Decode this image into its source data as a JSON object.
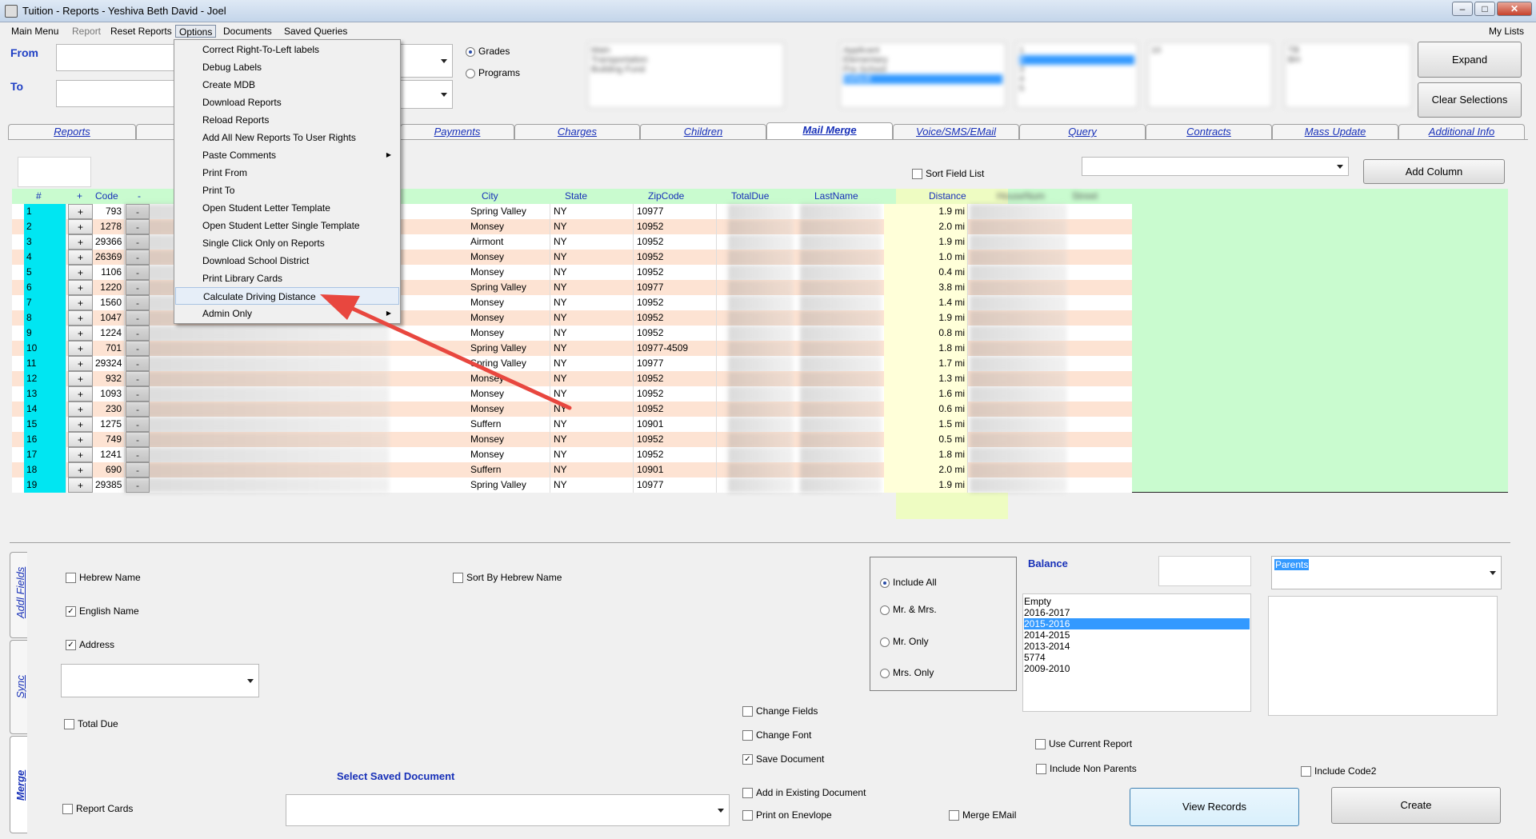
{
  "window": {
    "title": "Tuition - Reports - Yeshiva Beth David - Joel"
  },
  "menubar": {
    "items": [
      "Main Menu",
      "Report",
      "Reset Reports",
      "Options",
      "Documents",
      "Saved Queries"
    ],
    "right": "My Lists"
  },
  "filters": {
    "from_label": "From",
    "to_label": "To",
    "grades_label": "Grades",
    "programs_label": "Programs",
    "list1": [
      "Main",
      "Transportation",
      "Building Fund"
    ],
    "list2": [
      "Applicant",
      "Elementary",
      "Pre School",
      "Default"
    ],
    "list3": [
      "1",
      "2",
      "3",
      "4",
      "5"
    ],
    "list4": [
      "10"
    ],
    "list5": [
      "TB",
      "BH"
    ]
  },
  "buttons": {
    "expand": "Expand",
    "clear": "Clear Selections",
    "add_column": "Add Column",
    "view_records": "View Records",
    "create": "Create"
  },
  "options_menu": [
    "Correct Right-To-Left labels",
    "Debug Labels",
    "Create MDB",
    "Download Reports",
    "Reload Reports",
    "Add All New Reports To User Rights",
    "Paste Comments",
    "Print From",
    "Print To",
    "Open Student Letter Template",
    "Open Student Letter Single Template",
    "Single Click Only on Reports",
    "Download School District",
    "Print Library Cards",
    "Calculate Driving Distance",
    "Admin Only"
  ],
  "tabs": [
    "Reports",
    "Payments",
    "Charges",
    "Children",
    "Mail Merge",
    "Voice/SMS/EMail",
    "Query",
    "Contracts",
    "Mass Update",
    "Additional Info"
  ],
  "active_tab": "Mail Merge",
  "sort_field_list": "Sort Field List",
  "grid": {
    "headers": [
      "#",
      "+",
      "Code",
      "-",
      "City",
      "State",
      "ZipCode",
      "TotalDue",
      "LastName",
      "Distance",
      "HouseNum",
      "Street"
    ],
    "rows": [
      {
        "n": "1",
        "code": "793",
        "city": "Spring Valley",
        "state": "NY",
        "zip": "10977",
        "dist": "1.9 mi"
      },
      {
        "n": "2",
        "code": "1278",
        "city": "Monsey",
        "state": "NY",
        "zip": "10952",
        "dist": "2.0 mi"
      },
      {
        "n": "3",
        "code": "29366",
        "city": "Airmont",
        "state": "NY",
        "zip": "10952",
        "dist": "1.9 mi"
      },
      {
        "n": "4",
        "code": "26369",
        "city": "Monsey",
        "state": "NY",
        "zip": "10952",
        "dist": "1.0 mi"
      },
      {
        "n": "5",
        "code": "1106",
        "city": "Monsey",
        "state": "NY",
        "zip": "10952",
        "dist": "0.4 mi"
      },
      {
        "n": "6",
        "code": "1220",
        "city": "Spring Valley",
        "state": "NY",
        "zip": "10977",
        "dist": "3.8 mi"
      },
      {
        "n": "7",
        "code": "1560",
        "city": "Monsey",
        "state": "NY",
        "zip": "10952",
        "dist": "1.4 mi"
      },
      {
        "n": "8",
        "code": "1047",
        "city": "Monsey",
        "state": "NY",
        "zip": "10952",
        "dist": "1.9 mi"
      },
      {
        "n": "9",
        "code": "1224",
        "city": "Monsey",
        "state": "NY",
        "zip": "10952",
        "dist": "0.8 mi"
      },
      {
        "n": "10",
        "code": "701",
        "city": "Spring Valley",
        "state": "NY",
        "zip": "10977-4509",
        "dist": "1.8 mi"
      },
      {
        "n": "11",
        "code": "29324",
        "city": "Spring Valley",
        "state": "NY",
        "zip": "10977",
        "dist": "1.7 mi"
      },
      {
        "n": "12",
        "code": "932",
        "city": "Monsey",
        "state": "NY",
        "zip": "10952",
        "dist": "1.3 mi"
      },
      {
        "n": "13",
        "code": "1093",
        "city": "Monsey",
        "state": "NY",
        "zip": "10952",
        "dist": "1.6 mi"
      },
      {
        "n": "14",
        "code": "230",
        "city": "Monsey",
        "state": "NY",
        "zip": "10952",
        "dist": "0.6 mi"
      },
      {
        "n": "15",
        "code": "1275",
        "city": "Suffern",
        "state": "NY",
        "zip": "10901",
        "dist": "1.5 mi"
      },
      {
        "n": "16",
        "code": "749",
        "city": "Monsey",
        "state": "NY",
        "zip": "10952",
        "dist": "0.5 mi"
      },
      {
        "n": "17",
        "code": "1241",
        "city": "Monsey",
        "state": "NY",
        "zip": "10952",
        "dist": "1.8 mi"
      },
      {
        "n": "18",
        "code": "690",
        "city": "Suffern",
        "state": "NY",
        "zip": "10901",
        "dist": "2.0 mi"
      },
      {
        "n": "19",
        "code": "29385",
        "city": "Spring Valley",
        "state": "NY",
        "zip": "10977",
        "dist": "1.9 mi"
      }
    ]
  },
  "side_tabs": [
    "Addl Fields",
    "Sync",
    "Merge"
  ],
  "merge": {
    "hebrew_name": "Hebrew Name",
    "sort_by_hebrew": "Sort By Hebrew Name",
    "english_name": "English Name",
    "address": "Address",
    "total_due": "Total Due",
    "report_cards": "Report Cards",
    "select_saved_document": "Select Saved Document",
    "include_all": "Include All",
    "mr_mrs": "Mr. & Mrs.",
    "mr_only": "Mr. Only",
    "mrs_only": "Mrs. Only",
    "balance": "Balance",
    "balance_years": [
      "Empty",
      "2016-2017",
      "2015-2016",
      "2014-2015",
      "2013-2014",
      "5774",
      "2009-2010"
    ],
    "balance_selected": "2015-2016",
    "parents": "Parents",
    "change_fields": "Change Fields",
    "change_font": "Change Font",
    "save_document": "Save Document",
    "add_existing": "Add in Existing Document",
    "print_envelope": "Print on Enevlope",
    "merge_email": "Merge EMail",
    "use_current_report": "Use Current Report",
    "include_non_parents": "Include Non Parents",
    "include_code2": "Include Code2"
  },
  "colors": {
    "accent": "#1730b8",
    "grid_bg": "#c9fbcf",
    "row_alt": "#fde3d3",
    "num_col": "#00e6f2",
    "distance_col": "#ffffd9"
  }
}
